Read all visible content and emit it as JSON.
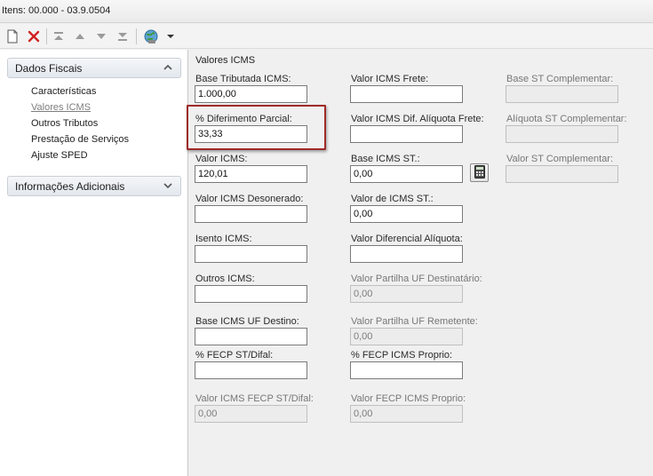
{
  "window": {
    "title": "Itens: 00.000 - 03.9.0504"
  },
  "toolbar": {
    "new_icon": "new-document-icon",
    "delete_icon": "delete-x-icon",
    "first_icon": "move-first-icon",
    "up_icon": "move-up-icon",
    "down_icon": "move-down-icon",
    "last_icon": "move-last-icon",
    "globe_icon": "globe-icon",
    "dropdown_icon": "dropdown-arrow-icon"
  },
  "sidebar": {
    "group1": {
      "label": "Dados Fiscais",
      "items": [
        "Características",
        "Valores ICMS",
        "Outros Tributos",
        "Prestação de Serviços",
        "Ajuste SPED"
      ]
    },
    "group2": {
      "label": "Informações Adicionais"
    }
  },
  "form": {
    "section_title": "Valores ICMS",
    "base_tributada": {
      "label": "Base Tributada ICMS:",
      "value": "1.000,00"
    },
    "diferimento": {
      "label": "% Diferimento Parcial:",
      "value": "33,33"
    },
    "valor_icms": {
      "label": "Valor ICMS:",
      "value": "120,01"
    },
    "valor_desonerado": {
      "label": "Valor ICMS Desonerado:",
      "value": ""
    },
    "isento": {
      "label": "Isento ICMS:",
      "value": ""
    },
    "outros": {
      "label": "Outros ICMS:",
      "value": ""
    },
    "base_uf_destino": {
      "label": "Base ICMS UF Destino:",
      "value": ""
    },
    "fecp_st_difal": {
      "label": "% FECP ST/Difal:",
      "value": ""
    },
    "valor_fecp_st_difal": {
      "label": "Valor ICMS FECP ST/Difal:",
      "value": "0,00"
    },
    "valor_frete": {
      "label": "Valor ICMS Frete:",
      "value": ""
    },
    "valor_dif_aliquota_frete": {
      "label": "Valor ICMS Dif. Alíquota Frete:",
      "value": ""
    },
    "base_st": {
      "label": "Base ICMS ST.:",
      "value": "0,00"
    },
    "valor_icms_st": {
      "label": "Valor de ICMS ST.:",
      "value": "0,00"
    },
    "valor_diferencial_aliquota": {
      "label": "Valor Diferencial Alíquota:",
      "value": ""
    },
    "partilha_destinatario": {
      "label": "Valor Partilha UF Destinatário:",
      "value": "0,00"
    },
    "partilha_remetente": {
      "label": "Valor Partilha UF Remetente:",
      "value": "0,00"
    },
    "fecp_proprio": {
      "label": "% FECP ICMS Proprio:",
      "value": ""
    },
    "valor_fecp_proprio": {
      "label": "Valor FECP ICMS Proprio:",
      "value": "0,00"
    },
    "base_st_complementar": {
      "label": "Base ST Complementar:",
      "value": ""
    },
    "aliquota_st_complementar": {
      "label": "Alíquota ST Complementar:",
      "value": ""
    },
    "valor_st_complementar": {
      "label": "Valor ST Complementar:",
      "value": ""
    },
    "calculator_icon": "calculator-icon"
  },
  "colors": {
    "highlight_border": "#9e2a2a",
    "active_nav": "#7d7d7d"
  }
}
